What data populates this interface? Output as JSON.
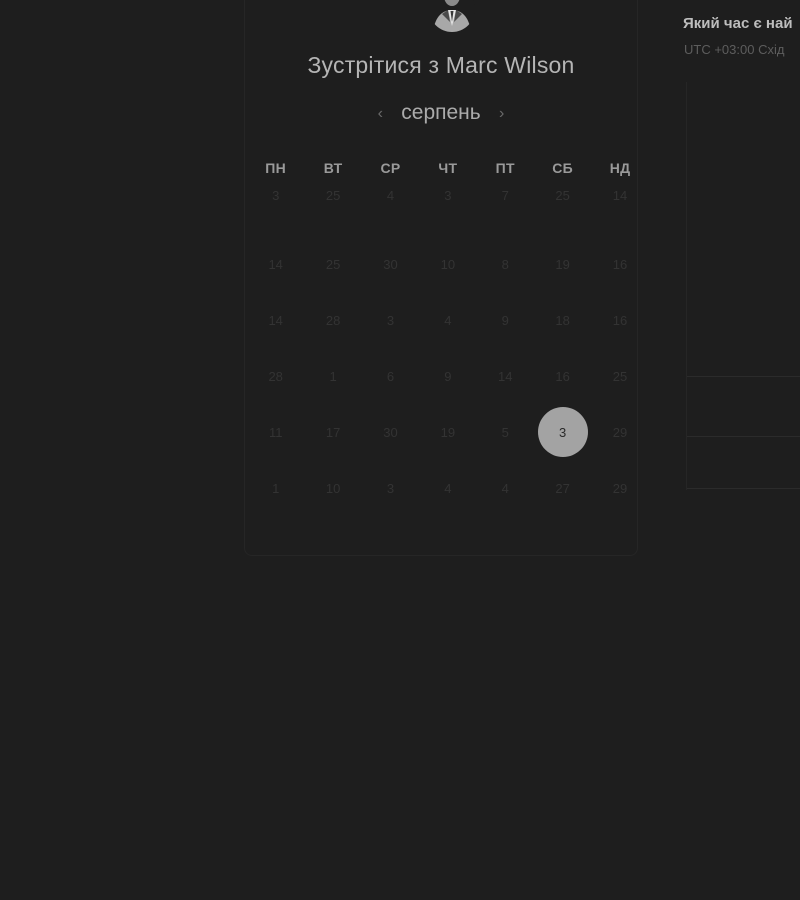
{
  "booking": {
    "title": "Зустрітися з Marc Wilson",
    "month": "серпень",
    "prev_icon": "‹",
    "next_icon": "›"
  },
  "calendar": {
    "weekdays": [
      "ПН",
      "ВТ",
      "СР",
      "ЧТ",
      "ПТ",
      "СБ",
      "НД"
    ],
    "weeks": [
      [
        "3",
        "25",
        "4",
        "3",
        "7",
        "25",
        "14"
      ],
      [
        "14",
        "25",
        "30",
        "10",
        "8",
        "19",
        "16"
      ],
      [
        "14",
        "28",
        "3",
        "4",
        "9",
        "18",
        "16"
      ],
      [
        "28",
        "1",
        "6",
        "9",
        "14",
        "16",
        "25"
      ],
      [
        "11",
        "17",
        "30",
        "19",
        "5",
        "3",
        "29"
      ],
      [
        "1",
        "10",
        "3",
        "4",
        "4",
        "27",
        "29"
      ]
    ],
    "selected_day": "3"
  },
  "timezone": {
    "question": "Який час є най",
    "label": "UTC +03:00 Схід"
  },
  "colors": {
    "background": "#1e1e1e",
    "selected_day_bg": "#a3a3a3"
  }
}
